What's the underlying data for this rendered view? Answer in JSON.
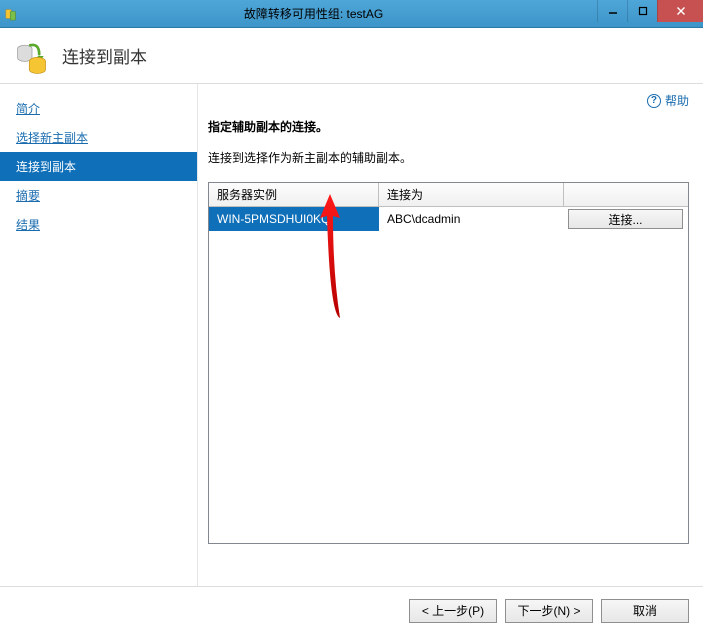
{
  "titlebar": {
    "title": "故障转移可用性组: testAG"
  },
  "header": {
    "title": "连接到副本"
  },
  "sidebar": {
    "items": [
      {
        "label": "简介"
      },
      {
        "label": "选择新主副本"
      },
      {
        "label": "连接到副本"
      },
      {
        "label": "摘要"
      },
      {
        "label": "结果"
      }
    ],
    "activeIndex": 2
  },
  "main": {
    "help_label": "帮助",
    "instruction_bold": "指定辅助副本的连接。",
    "instruction_sub": "连接到选择作为新主副本的辅助副本。",
    "table": {
      "headers": {
        "instance": "服务器实例",
        "connect_as": "连接为",
        "action": ""
      },
      "rows": [
        {
          "instance": "WIN-5PMSDHUI0KQ",
          "connect_as": "ABC\\dcadmin",
          "button_label": "连接..."
        }
      ]
    }
  },
  "footer": {
    "prev": "< 上一步(P)",
    "next": "下一步(N) >",
    "cancel": "取消"
  }
}
